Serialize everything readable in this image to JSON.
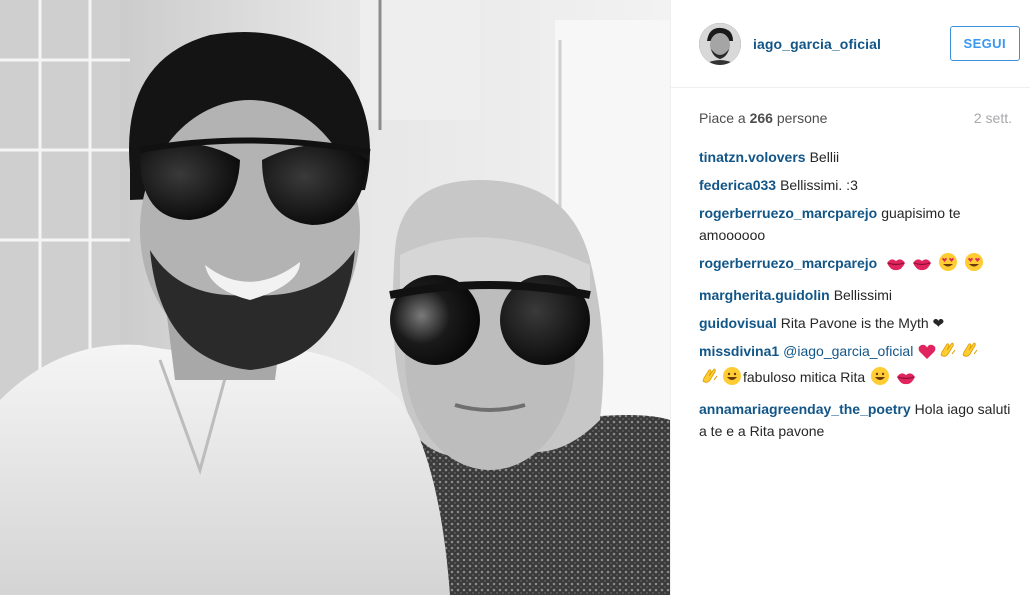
{
  "post": {
    "username": "iago_garcia_oficial",
    "follow_label": "SEGUI",
    "likes_prefix": "Piace a",
    "likes_count": "266",
    "likes_suffix": "persone",
    "timestamp": "2 sett."
  },
  "comments": [
    {
      "user": "tinatzn.volovers",
      "text": "Bellii"
    },
    {
      "user": "federica033",
      "text": "Bellissimi. :3"
    },
    {
      "user": "rogerberruezo_marcparejo",
      "text": "guapisimo te amoooooo"
    },
    {
      "user": "rogerberruezo_marcparejo",
      "text": "",
      "emojis": [
        "lips",
        "lips",
        "heart-eyes",
        "heart-eyes"
      ]
    },
    {
      "user": "margherita.guidolin",
      "text": "Bellissimi"
    },
    {
      "user": "guidovisual",
      "text": "Rita Pavone is the Myth ❤"
    },
    {
      "user": "missdivina1",
      "mention": "@iago_garcia_oficial",
      "text": "fabuloso mitica Rita"
    },
    {
      "user": "annamariagreenday_the_poetry",
      "text": "Hola iago saluti a te e a Rita pavone"
    }
  ],
  "colors": {
    "username": "#125688",
    "follow_border": "#4090db",
    "timestamp": "#a5a7aa"
  },
  "icons": {
    "lips": "kiss-lips-icon",
    "heart": "red-heart-icon",
    "clap": "clapping-hands-icon",
    "grin": "grinning-face-icon",
    "heart_eyes": "heart-eyes-face-icon"
  }
}
